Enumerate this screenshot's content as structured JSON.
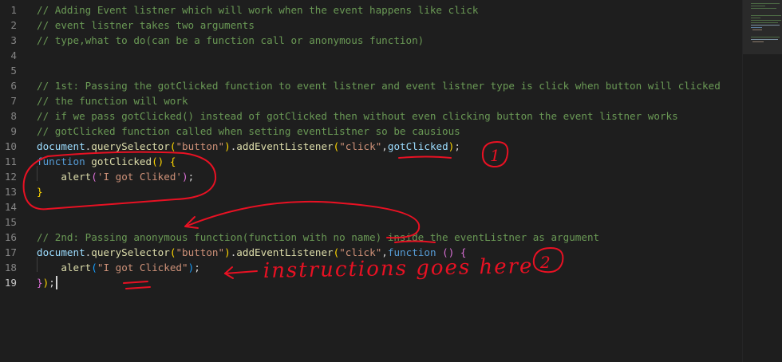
{
  "editor": {
    "active_line": 19,
    "lines": [
      {
        "num": "1",
        "tokens": [
          {
            "t": "// Adding Event listner which will work when the event happens like click",
            "c": "com"
          }
        ]
      },
      {
        "num": "2",
        "tokens": [
          {
            "t": "// event listner takes two arguments",
            "c": "com"
          }
        ]
      },
      {
        "num": "3",
        "tokens": [
          {
            "t": "// type,what to do(can be a function call or anonymous function)",
            "c": "com"
          }
        ]
      },
      {
        "num": "4",
        "tokens": []
      },
      {
        "num": "5",
        "tokens": []
      },
      {
        "num": "6",
        "tokens": [
          {
            "t": "// 1st: Passing the gotClicked function to event listner and event listner type is click when button will clicked",
            "c": "com"
          }
        ]
      },
      {
        "num": "7",
        "tokens": [
          {
            "t": "// the function will work",
            "c": "com"
          }
        ]
      },
      {
        "num": "8",
        "tokens": [
          {
            "t": "// if we pass gotClicked() instead of gotClicked then without even clicking button the event listner works",
            "c": "com"
          }
        ]
      },
      {
        "num": "9",
        "tokens": [
          {
            "t": "// gotClicked function called when setting eventListner so be causious",
            "c": "com"
          }
        ]
      },
      {
        "num": "10",
        "tokens": [
          {
            "t": "document",
            "c": "id"
          },
          {
            "t": ".",
            "c": "pl"
          },
          {
            "t": "querySelector",
            "c": "fn"
          },
          {
            "t": "(",
            "c": "br1"
          },
          {
            "t": "\"button\"",
            "c": "str"
          },
          {
            "t": ")",
            "c": "br1"
          },
          {
            "t": ".",
            "c": "pl"
          },
          {
            "t": "addEventListener",
            "c": "fn"
          },
          {
            "t": "(",
            "c": "br1"
          },
          {
            "t": "\"click\"",
            "c": "str"
          },
          {
            "t": ",",
            "c": "pl"
          },
          {
            "t": "gotClicked",
            "c": "id"
          },
          {
            "t": ")",
            "c": "br1"
          },
          {
            "t": ";",
            "c": "pl"
          }
        ]
      },
      {
        "num": "11",
        "tokens": [
          {
            "t": "function",
            "c": "kw"
          },
          {
            "t": " ",
            "c": "pl"
          },
          {
            "t": "gotClicked",
            "c": "fn"
          },
          {
            "t": "()",
            "c": "br1"
          },
          {
            "t": " ",
            "c": "pl"
          },
          {
            "t": "{",
            "c": "br1"
          }
        ]
      },
      {
        "num": "12",
        "tokens": [
          {
            "t": "    ",
            "c": "pl"
          },
          {
            "t": "alert",
            "c": "fn"
          },
          {
            "t": "(",
            "c": "br2"
          },
          {
            "t": "'I got Cliked'",
            "c": "str"
          },
          {
            "t": ")",
            "c": "br2"
          },
          {
            "t": ";",
            "c": "pl"
          }
        ]
      },
      {
        "num": "13",
        "tokens": [
          {
            "t": "}",
            "c": "br1"
          }
        ]
      },
      {
        "num": "14",
        "tokens": []
      },
      {
        "num": "15",
        "tokens": []
      },
      {
        "num": "16",
        "tokens": [
          {
            "t": "// 2nd: Passing anonymous function(function with no name) inside the eventListner as argument",
            "c": "com"
          }
        ]
      },
      {
        "num": "17",
        "tokens": [
          {
            "t": "document",
            "c": "id"
          },
          {
            "t": ".",
            "c": "pl"
          },
          {
            "t": "querySelector",
            "c": "fn"
          },
          {
            "t": "(",
            "c": "br1"
          },
          {
            "t": "\"button\"",
            "c": "str"
          },
          {
            "t": ")",
            "c": "br1"
          },
          {
            "t": ".",
            "c": "pl"
          },
          {
            "t": "addEventListener",
            "c": "fn"
          },
          {
            "t": "(",
            "c": "br1"
          },
          {
            "t": "\"click\"",
            "c": "str"
          },
          {
            "t": ",",
            "c": "pl"
          },
          {
            "t": "function",
            "c": "kw"
          },
          {
            "t": " ",
            "c": "pl"
          },
          {
            "t": "()",
            "c": "br2"
          },
          {
            "t": " ",
            "c": "pl"
          },
          {
            "t": "{",
            "c": "br2"
          }
        ]
      },
      {
        "num": "18",
        "tokens": [
          {
            "t": "    ",
            "c": "pl"
          },
          {
            "t": "alert",
            "c": "fn"
          },
          {
            "t": "(",
            "c": "br3"
          },
          {
            "t": "\"I got Clicked\"",
            "c": "str"
          },
          {
            "t": ")",
            "c": "br3"
          },
          {
            "t": ";",
            "c": "pl"
          }
        ]
      },
      {
        "num": "19",
        "tokens": [
          {
            "t": "}",
            "c": "br2"
          },
          {
            "t": ")",
            "c": "br1"
          },
          {
            "t": ";",
            "c": "pl"
          }
        ]
      }
    ]
  },
  "annotations": {
    "label_1": "1",
    "label_2": "2",
    "note": "instructions goes here",
    "color": "#e81123"
  }
}
